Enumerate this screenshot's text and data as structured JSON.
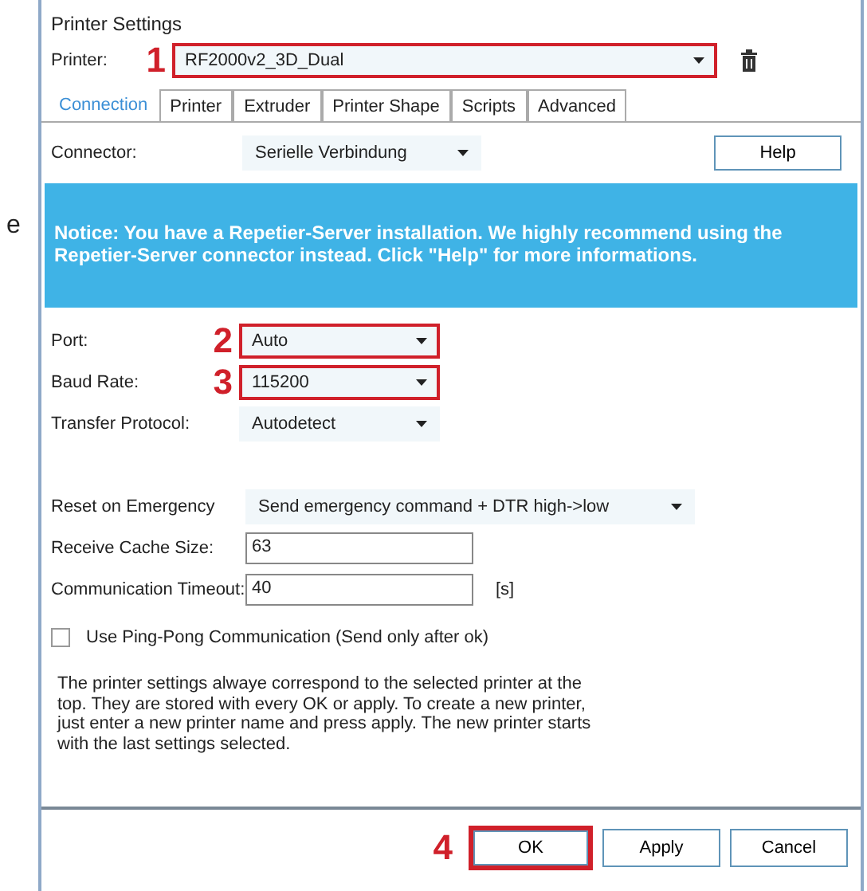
{
  "edge_text": "e",
  "window": {
    "title": "Printer Settings"
  },
  "printer": {
    "label": "Printer:",
    "value": "RF2000v2_3D_Dual",
    "callout": "1",
    "highlighted": true
  },
  "tabs": [
    {
      "label": "Connection",
      "selected": true
    },
    {
      "label": "Printer",
      "selected": false
    },
    {
      "label": "Extruder",
      "selected": false
    },
    {
      "label": "Printer Shape",
      "selected": false
    },
    {
      "label": "Scripts",
      "selected": false
    },
    {
      "label": "Advanced",
      "selected": false
    }
  ],
  "connector": {
    "label": "Connector:",
    "value": "Serielle Verbindung",
    "help_button": "Help"
  },
  "notice": "Notice: You have a Repetier-Server installation. We highly recommend using the Repetier-Server connector instead. Click \"Help\" for more informations.",
  "serial_fields": [
    {
      "label": "Port:",
      "value": "Auto",
      "callout": "2",
      "highlighted": true
    },
    {
      "label": "Baud Rate:",
      "value": "115200",
      "callout": "3",
      "highlighted": true
    },
    {
      "label": "Transfer Protocol:",
      "value": "Autodetect",
      "highlighted": false
    }
  ],
  "reset_on_emergency": {
    "label": "Reset on Emergency",
    "value": "Send emergency command + DTR high->low"
  },
  "receive_cache": {
    "label": "Receive Cache Size:",
    "value": "63"
  },
  "timeout": {
    "label": "Communication Timeout:",
    "value": "40",
    "unit": "[s]"
  },
  "ping_pong": {
    "label": "Use Ping-Pong Communication (Send only after ok)",
    "checked": false
  },
  "info": "The printer settings alwaye correspond to the selected printer at the top. They are stored with every OK or apply. To create a new printer, just enter a new printer name and press apply. The new printer starts with the last settings selected.",
  "buttons": [
    {
      "label": "OK",
      "callout": "4",
      "highlighted": true
    },
    {
      "label": "Apply",
      "highlighted": false
    },
    {
      "label": "Cancel",
      "highlighted": false
    }
  ]
}
